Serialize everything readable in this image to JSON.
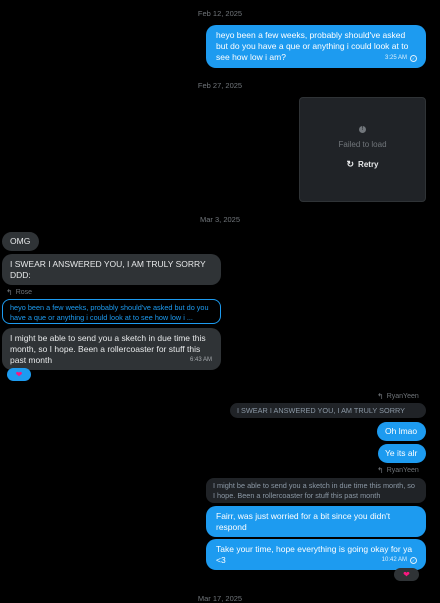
{
  "dates": {
    "d1": "Feb 12, 2025",
    "d2": "Feb 27, 2025",
    "d3": "Mar 3, 2025",
    "d4": "Mar 17, 2025"
  },
  "messages": {
    "m1": {
      "text": "heyo been a few weeks, probably should've asked but do you have a que or anything i could look at to see how low i am?",
      "time": "3:25 AM"
    },
    "media": {
      "error": "Failed to load",
      "retry": "Retry"
    },
    "m2": {
      "text": "OMG"
    },
    "m3": {
      "text": "I SWEAR I ANSWERED YOU, I AM TRULY SORRY DDD:"
    },
    "m4": {
      "reply_to": "Rose",
      "quote": "heyo been a few weeks, probably should've asked but do you have a que or anything i could look at to see how low i ...",
      "text": "I might be able to send you a sketch in due time this month, so I hope. Been a rollercoaster for stuff this past month",
      "time": "6:43 AM"
    },
    "m5": {
      "reply_to": "RyanYeen",
      "quote": "I SWEAR I ANSWERED YOU, I AM TRULY SORRY DDD:",
      "text1": "Oh lmao",
      "text2": "Ye its alr"
    },
    "m6": {
      "reply_to": "RyanYeen",
      "quote": "I might be able to send you a sketch in due time this month, so I hope. Been a rollercoaster for stuff this past month",
      "text1": "Fairr, was just worried for a bit since you didn't respond",
      "text2": "Take your time, hope everything is going okay for ya <3",
      "time": "10:42 AM"
    }
  },
  "reactions": {
    "heart": "❤"
  },
  "colors": {
    "accent": "#1d9bf0",
    "bubble_grey": "#2f3336",
    "heart": "#f91880"
  },
  "icons": {
    "reply": "reply-icon",
    "retry": "refresh-icon",
    "check": "check-icon",
    "alert": "info-icon"
  }
}
